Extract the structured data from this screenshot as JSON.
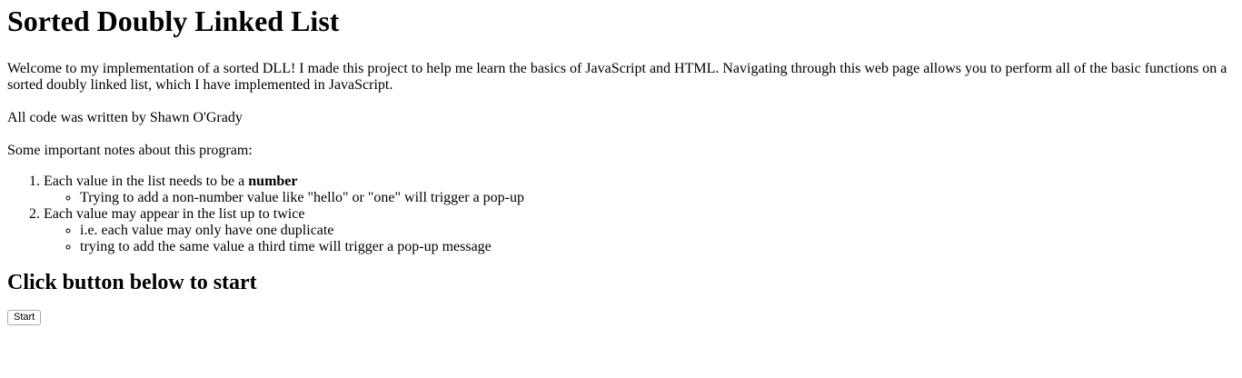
{
  "page": {
    "title": "Sorted Doubly Linked List",
    "intro": "Welcome to my implementation of a sorted DLL! I made this project to help me learn the basics of JavaScript and HTML. Navigating through this web page allows you to perform all of the basic functions on a sorted doubly linked list, which I have implemented in JavaScript.",
    "author": "All code was written by Shawn O'Grady",
    "notes_label": "Some important notes about this program:",
    "notes": [
      {
        "text_prefix": "Each value in the list needs to be a ",
        "text_bold": "number",
        "subitems": [
          "Trying to add a non-number value like \"hello\" or \"one\" will trigger a pop-up"
        ]
      },
      {
        "text_prefix": "Each value may appear in the list up to twice",
        "text_bold": "",
        "subitems": [
          "i.e. each value may only have one duplicate",
          "trying to add the same value a third time will trigger a pop-up message"
        ]
      }
    ],
    "start_heading": "Click button below to start",
    "start_button_label": "Start"
  }
}
